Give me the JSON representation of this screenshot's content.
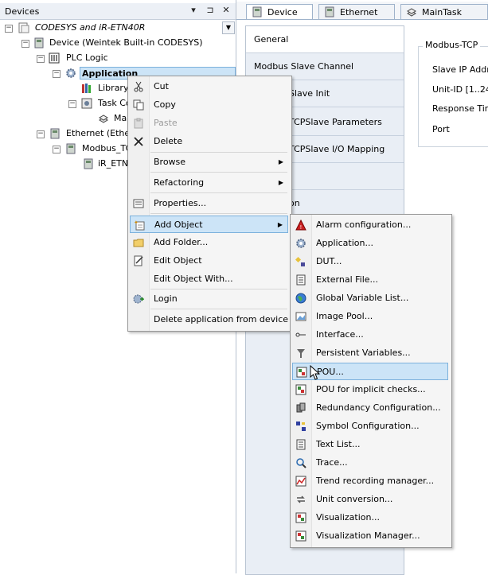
{
  "devices_panel": {
    "title": "Devices",
    "buttons": {
      "menu": "▾",
      "pin": "⊐",
      "close": "✕"
    },
    "tree": [
      {
        "label": "CODESYS and iR-ETN40R",
        "icon": "project-icon",
        "italic": true
      },
      {
        "label": "Device (Weintek Built-in CODESYS)",
        "icon": "device-icon"
      },
      {
        "label": "PLC Logic",
        "icon": "plc-logic-icon"
      },
      {
        "label": "Application",
        "icon": "application-gear-icon"
      },
      {
        "label": "Library",
        "icon": "library-icon"
      },
      {
        "label": "Task Co",
        "icon": "task-config-icon"
      },
      {
        "label": "Mai",
        "icon": "task-icon"
      },
      {
        "label": "Ethernet (Ether",
        "icon": "ethernet-icon"
      },
      {
        "label": "Modbus_TC",
        "icon": "modbus-icon"
      },
      {
        "label": "iR_ETN-",
        "icon": "module-icon"
      }
    ]
  },
  "tabs": [
    {
      "label": "Device",
      "icon": "device-tab-icon"
    },
    {
      "label": "Ethernet",
      "icon": "ethernet-tab-icon"
    },
    {
      "label": "MainTask",
      "icon": "maintask-tab-icon"
    }
  ],
  "config_nav": [
    "General",
    "Modbus Slave Channel",
    "Slave Init",
    "TCPSlave Parameters",
    "TCPSlave I/O Mapping",
    "",
    "on"
  ],
  "modbus_group": {
    "title": "Modbus-TCP",
    "fields": [
      "Slave IP Addre",
      "Unit-ID [1..247",
      "Response Tim",
      "Port"
    ]
  },
  "context_menu": {
    "items": [
      {
        "label": "Cut",
        "icon": "scissors-icon"
      },
      {
        "label": "Copy",
        "icon": "copy-icon"
      },
      {
        "label": "Paste",
        "icon": "paste-icon",
        "disabled": true
      },
      {
        "label": "Delete",
        "icon": "delete-x-icon"
      },
      {
        "label": "Browse",
        "submenu": true
      },
      {
        "label": "Refactoring",
        "submenu": true
      },
      {
        "label": "Properties...",
        "icon": "properties-icon"
      },
      {
        "label": "Add Object",
        "icon": "add-object-icon",
        "submenu": true,
        "highlighted": true
      },
      {
        "label": "Add Folder...",
        "icon": "folder-icon"
      },
      {
        "label": "Edit Object",
        "icon": "edit-object-icon"
      },
      {
        "label": "Edit Object With..."
      },
      {
        "label": "Login",
        "icon": "login-icon"
      },
      {
        "label": "Delete application from device"
      }
    ]
  },
  "submenu": {
    "items": [
      {
        "label": "Alarm configuration...",
        "icon": "alarm-icon"
      },
      {
        "label": "Application...",
        "icon": "application-icon"
      },
      {
        "label": "DUT...",
        "icon": "dut-icon"
      },
      {
        "label": "External File...",
        "icon": "external-file-icon"
      },
      {
        "label": "Global Variable List...",
        "icon": "globe-icon"
      },
      {
        "label": "Image Pool...",
        "icon": "image-pool-icon"
      },
      {
        "label": "Interface...",
        "icon": "interface-icon"
      },
      {
        "label": "Persistent Variables...",
        "icon": "persistent-vars-icon"
      },
      {
        "label": "POU...",
        "icon": "pou-icon",
        "highlighted": true
      },
      {
        "label": "POU for implicit checks...",
        "icon": "pou-checks-icon"
      },
      {
        "label": "Redundancy Configuration...",
        "icon": "redundancy-icon"
      },
      {
        "label": "Symbol Configuration...",
        "icon": "symbol-config-icon"
      },
      {
        "label": "Text List...",
        "icon": "text-list-icon"
      },
      {
        "label": "Trace...",
        "icon": "trace-icon"
      },
      {
        "label": "Trend recording manager...",
        "icon": "trend-icon"
      },
      {
        "label": "Unit conversion...",
        "icon": "unit-conversion-icon"
      },
      {
        "label": "Visualization...",
        "icon": "visualization-icon"
      },
      {
        "label": "Visualization Manager...",
        "icon": "visualization-manager-icon"
      }
    ]
  },
  "colors": {
    "highlight": "#cce4f7",
    "highlight_border": "#7cb1dc",
    "panel_header": "#ecf0f6",
    "nav_bg": "#e9eef5"
  }
}
